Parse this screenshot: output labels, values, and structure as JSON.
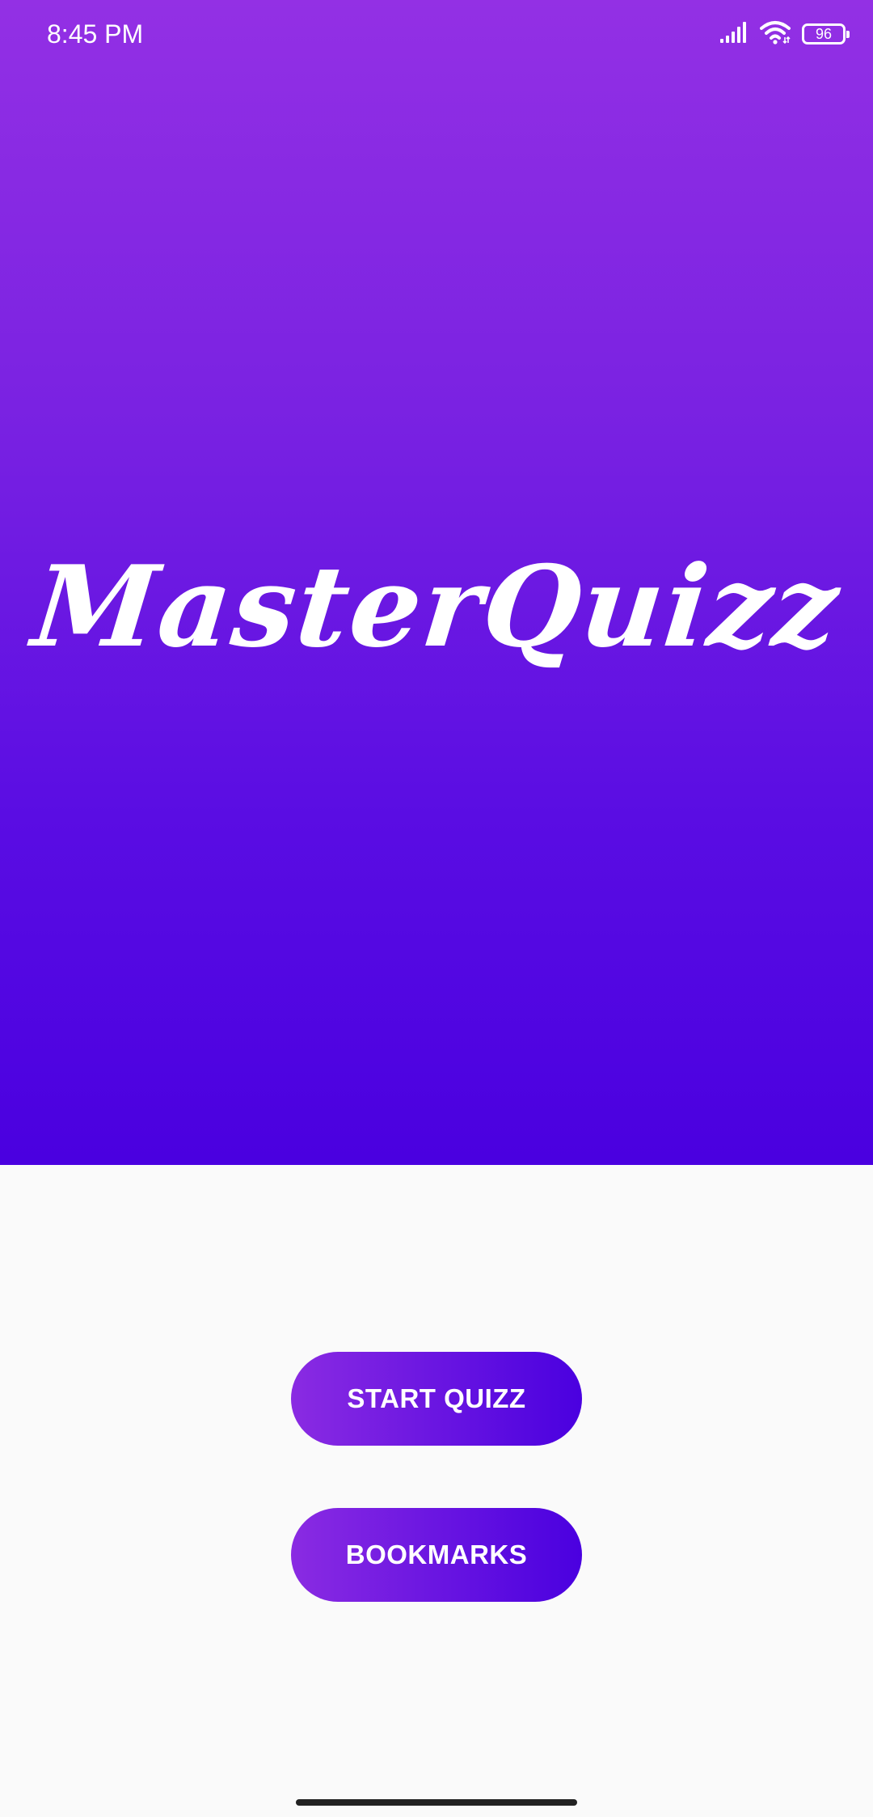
{
  "status_bar": {
    "time": "8:45 PM",
    "battery_level": "96",
    "icons": [
      "signal-icon",
      "wifi-icon",
      "battery-icon"
    ]
  },
  "hero": {
    "logo_text": "MasterQuizz",
    "gradient_top": "#9330e4",
    "gradient_bottom": "#4a00e0"
  },
  "actions": {
    "start_label": "START QUIZZ",
    "bookmarks_label": "BOOKMARKS",
    "button_gradient_start": "#8a2be2",
    "button_gradient_end": "#4a00e0"
  }
}
